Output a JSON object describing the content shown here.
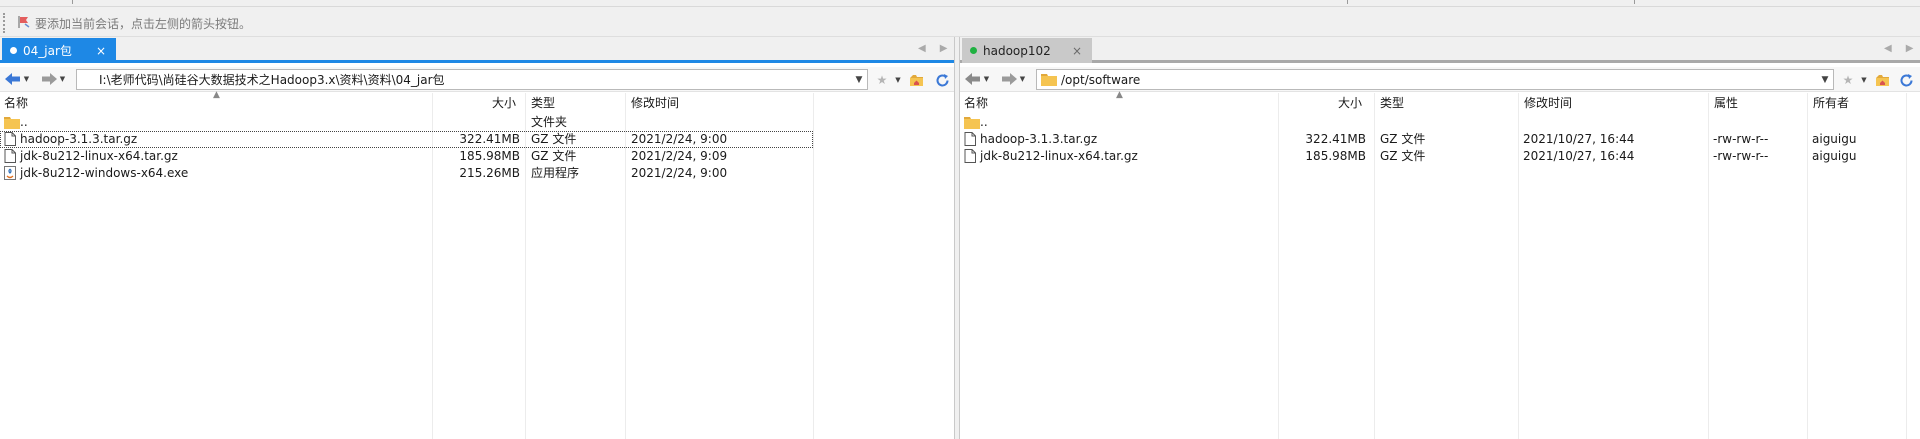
{
  "hint": {
    "text": "要添加当前会话，点击左侧的箭头按钮。"
  },
  "columns": {
    "name": "名称",
    "size": "大小",
    "type": "类型",
    "modified": "修改时间",
    "attrs": "属性",
    "owner": "所有者"
  },
  "left": {
    "tab": {
      "label": "04_jar包",
      "close": "×"
    },
    "path": "I:\\老师代码\\尚硅谷大数据技术之Hadoop3.x\\资料\\资料\\04_jar包",
    "files": [
      {
        "name": "..",
        "size": "",
        "type": "文件夹",
        "modified": "",
        "icon": "folder-icon"
      },
      {
        "name": "hadoop-3.1.3.tar.gz",
        "size": "322.41MB",
        "type": "GZ 文件",
        "modified": "2021/2/24, 9:00",
        "icon": "file-icon"
      },
      {
        "name": "jdk-8u212-linux-x64.tar.gz",
        "size": "185.98MB",
        "type": "GZ 文件",
        "modified": "2021/2/24, 9:09",
        "icon": "file-icon"
      },
      {
        "name": "jdk-8u212-windows-x64.exe",
        "size": "215.26MB",
        "type": "应用程序",
        "modified": "2021/2/24, 9:00",
        "icon": "java-exe-icon"
      }
    ]
  },
  "right": {
    "tab": {
      "label": "hadoop102",
      "close": "×"
    },
    "path": "/opt/software",
    "files": [
      {
        "name": "..",
        "size": "",
        "type": "",
        "modified": "",
        "attrs": "",
        "owner": "",
        "icon": "folder-icon"
      },
      {
        "name": "hadoop-3.1.3.tar.gz",
        "size": "322.41MB",
        "type": "GZ 文件",
        "modified": "2021/10/27, 16:44",
        "attrs": "-rw-rw-r--",
        "owner": "aiguigu",
        "icon": "file-icon"
      },
      {
        "name": "jdk-8u212-linux-x64.tar.gz",
        "size": "185.98MB",
        "type": "GZ 文件",
        "modified": "2021/10/27, 16:44",
        "attrs": "-rw-rw-r--",
        "owner": "aiguigu",
        "icon": "file-icon"
      }
    ]
  },
  "colors": {
    "accent": "#1e88e5",
    "connected": "#1fb141",
    "folder": "#f5c451"
  }
}
